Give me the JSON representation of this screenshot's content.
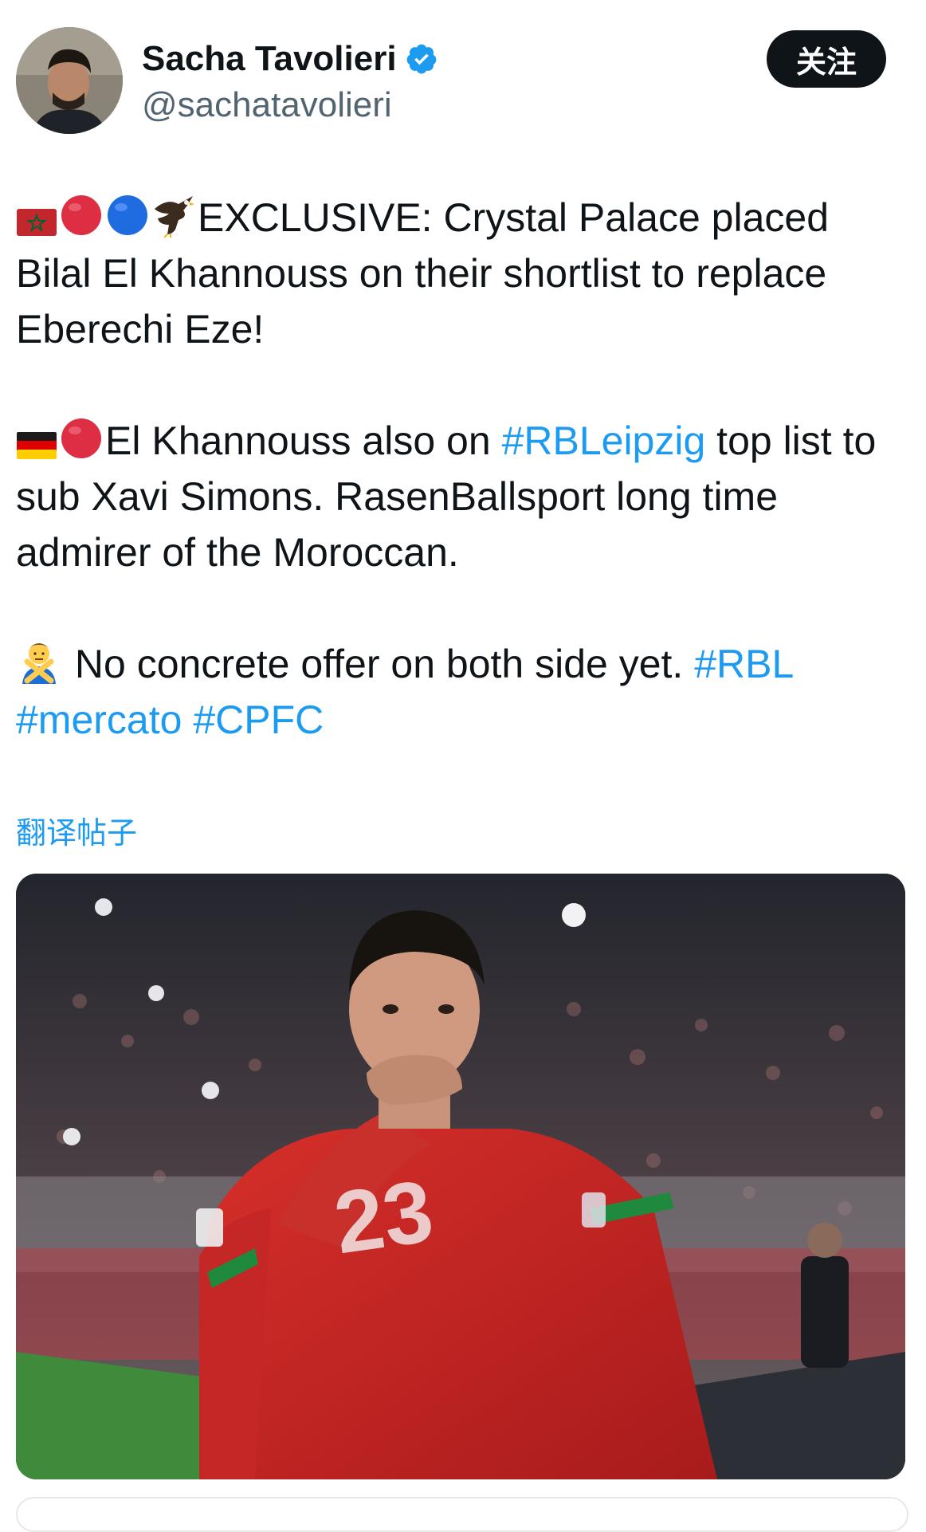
{
  "author": {
    "display_name": "Sacha Tavolieri",
    "handle": "@sachatavolieri",
    "verified": true,
    "verified_icon": "verified-badge-icon",
    "avatar_icon": "avatar"
  },
  "follow_button": {
    "label": "关注"
  },
  "tweet": {
    "paragraphs": [
      {
        "emojis": [
          "flag-morocco",
          "red-circle",
          "blue-circle",
          "eagle"
        ],
        "text": "EXCLUSIVE: Crystal Palace placed Bilal El Khannouss on their shortlist to replace Eberechi Eze!"
      },
      {
        "emojis": [
          "flag-germany",
          "red-circle"
        ],
        "text_before": "El Khannouss also on ",
        "hashtag": "#RBLeipzig",
        "text_after": " top list to sub Xavi Simons. RasenBallsport long time admirer of the Moroccan."
      },
      {
        "emojis": [
          "person-gesturing-no"
        ],
        "text": " No concrete offer on both side yet. ",
        "hashtags": [
          "#RBL",
          "#mercato",
          "#CPFC"
        ]
      }
    ]
  },
  "translate_link": "翻译帖子",
  "media": {
    "description_icon": "photo"
  },
  "colors": {
    "link": "#1d9bf0",
    "text": "#0f1419",
    "secondary": "#536471",
    "button_bg": "#0f1419"
  }
}
